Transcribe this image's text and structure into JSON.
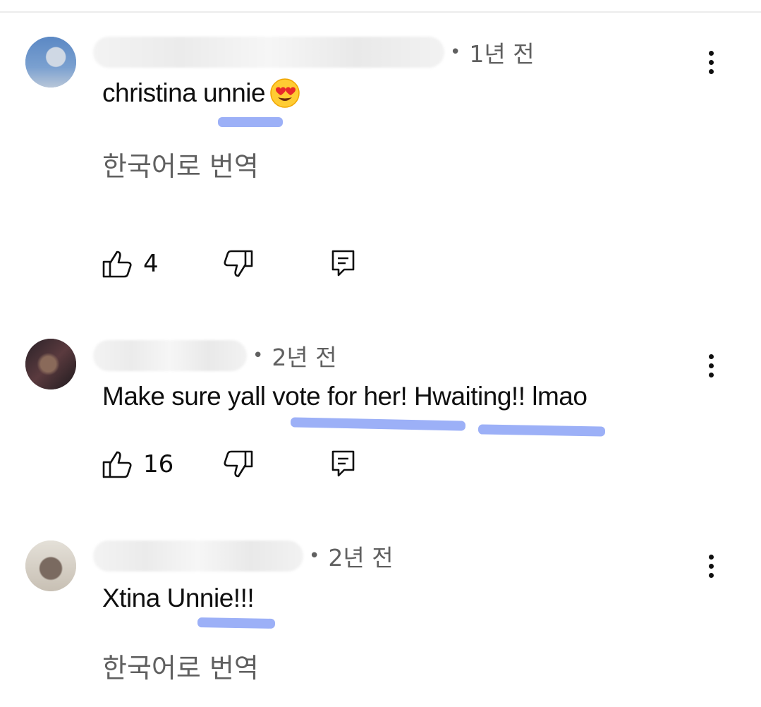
{
  "comments": [
    {
      "time": "1년 전",
      "text": "christina unnie",
      "translate_label": "한국어로 번역",
      "like_count": "4"
    },
    {
      "time": "2년 전",
      "text": "Make sure yall vote for her! Hwaiting!! lmao",
      "like_count": "16"
    },
    {
      "time": "2년 전",
      "text": "Xtina Unnie!!!",
      "translate_label": "한국어로 번역"
    }
  ],
  "icons": {
    "like": "thumbs-up-icon",
    "dislike": "thumbs-down-icon",
    "reply": "reply-icon",
    "more": "more-vertical-icon",
    "emoji": "heart-eyes-emoji"
  },
  "colors": {
    "text": "#0f0f0f",
    "secondary": "#606060",
    "highlight": "#9cb0f7"
  }
}
